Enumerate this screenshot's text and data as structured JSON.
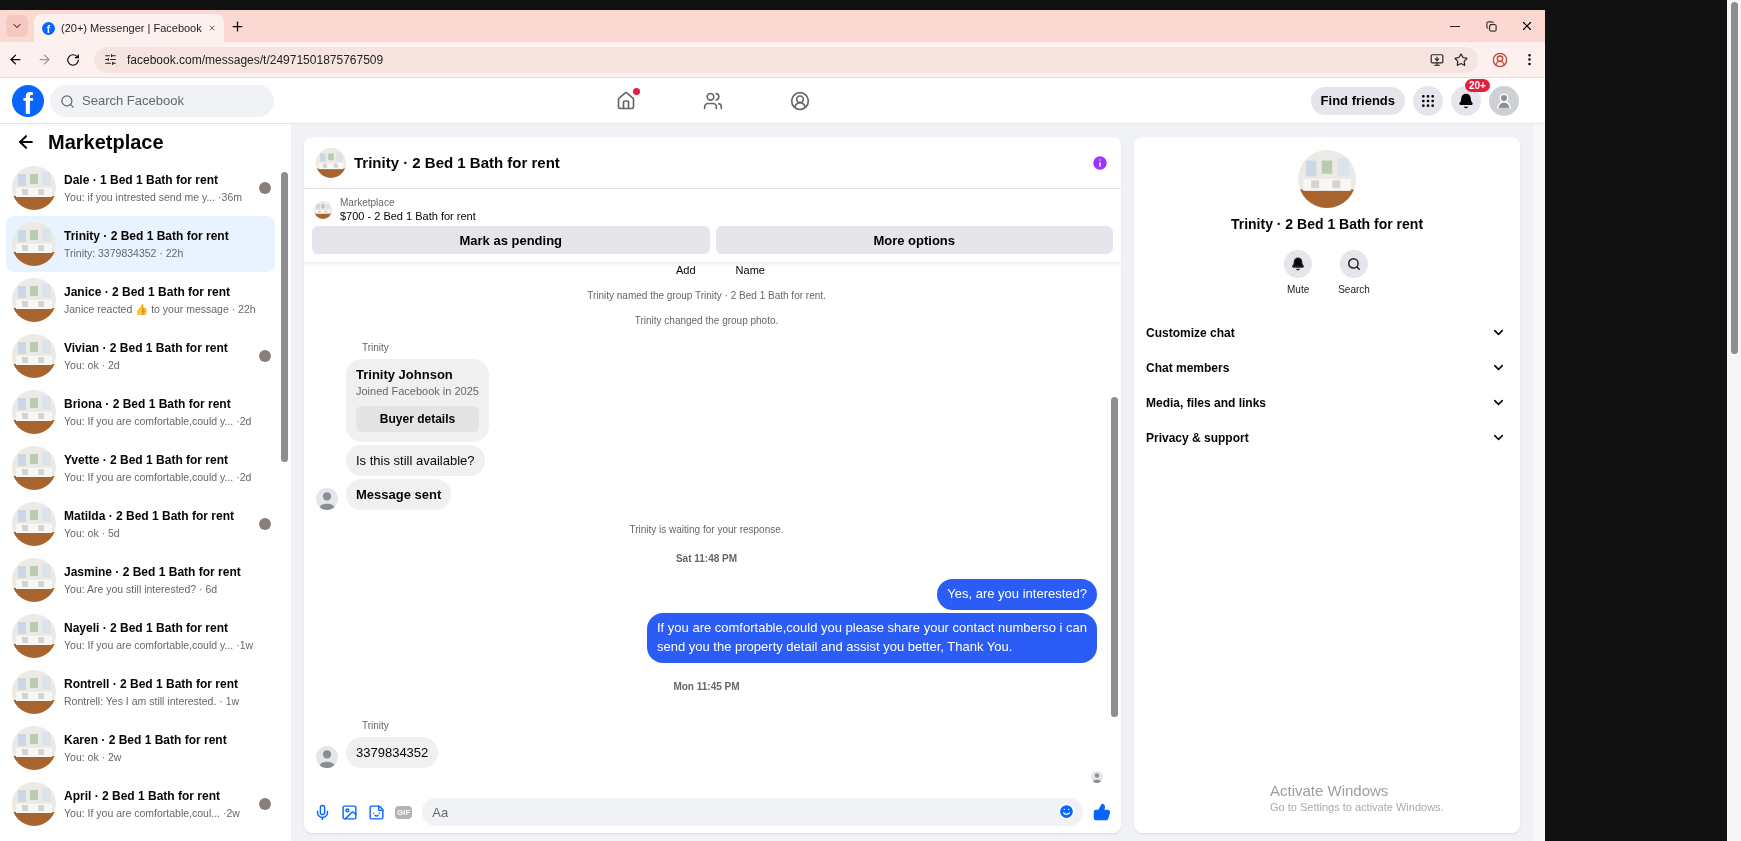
{
  "browser": {
    "favicon": "f",
    "tab_title": "(20+) Messenger | Facebook",
    "url": "facebook.com/messages/t/24971501875767509"
  },
  "header": {
    "logo": "f",
    "search_placeholder": "Search Facebook",
    "nav": [
      {
        "kind": "home",
        "notification_dot": true
      },
      {
        "kind": "friends",
        "notification_dot": false
      },
      {
        "kind": "groups",
        "notification_dot": false
      }
    ],
    "find_friends": "Find friends",
    "notifications_badge": "20+"
  },
  "sidebar": {
    "title": "Marketplace",
    "conversations": [
      {
        "title": "Dale · 1 Bed 1 Bath for rent",
        "preview": "You: if you intrested send me y... ·36m",
        "selected": false,
        "seen": true
      },
      {
        "title": "Trinity · 2 Bed 1 Bath for rent",
        "preview": "Trinity: 3379834352 · 22h",
        "selected": true,
        "seen": false
      },
      {
        "title": "Janice · 2 Bed 1 Bath for rent",
        "preview": "Janice reacted 👍 to your message · 22h",
        "selected": false,
        "seen": false
      },
      {
        "title": "Vivian · 2 Bed 1 Bath for rent",
        "preview": "You: ok · 2d",
        "selected": false,
        "seen": true
      },
      {
        "title": "Briona · 2 Bed 1 Bath for rent",
        "preview": "You: If you are comfortable,could y...  ·2d",
        "selected": false,
        "seen": false
      },
      {
        "title": "Yvette · 2 Bed 1 Bath for rent",
        "preview": "You: If you are comfortable,could y...  ·2d",
        "selected": false,
        "seen": false
      },
      {
        "title": "Matilda · 2 Bed 1 Bath for rent",
        "preview": "You: ok · 5d",
        "selected": false,
        "seen": true
      },
      {
        "title": "Jasmine · 2 Bed 1 Bath for rent",
        "preview": "You: Are you still interested? · 6d",
        "selected": false,
        "seen": false
      },
      {
        "title": "Nayeli · 2 Bed 1 Bath for rent",
        "preview": "You: If you are comfortable,could y...  ·1w",
        "selected": false,
        "seen": false
      },
      {
        "title": "Rontrell · 2 Bed 1 Bath for rent",
        "preview": "Rontrell: Yes I am still interested. · 1w",
        "selected": false,
        "seen": false
      },
      {
        "title": "Karen · 2 Bed 1 Bath for rent",
        "preview": "You: ok · 2w",
        "selected": false,
        "seen": false
      },
      {
        "title": "April · 2 Bed 1 Bath for rent",
        "preview": "You: If you are comfortable,coul...  ·2w",
        "selected": false,
        "seen": true
      }
    ]
  },
  "chat": {
    "title": "Trinity · 2 Bed 1 Bath for rent",
    "listing": {
      "label": "Marketplace",
      "price_line": "$700 - 2 Bed 1 Bath for rent"
    },
    "actions": [
      "Mark as pending",
      "More options"
    ],
    "cut_labels": [
      "Add",
      "Name"
    ],
    "messages": [
      {
        "kind": "system",
        "text": "Trinity named the group Trinity · 2 Bed 1 Bath for rent."
      },
      {
        "kind": "system",
        "text": "Trinity changed the group photo."
      },
      {
        "kind": "sender",
        "text": "Trinity"
      },
      {
        "kind": "profile_card",
        "name": "Trinity Johnson",
        "subtitle": "Joined Facebook in 2025",
        "button": "Buyer details"
      },
      {
        "kind": "incoming",
        "text": "Is this still available?",
        "avatar": false
      },
      {
        "kind": "notice",
        "text": "Message sent",
        "avatar": true
      },
      {
        "kind": "system",
        "text": "Trinity is waiting for your response."
      },
      {
        "kind": "time",
        "text": "Sat 11:48 PM"
      },
      {
        "kind": "outgoing",
        "text": "Yes, are you interested?"
      },
      {
        "kind": "outgoing",
        "text": "If you are comfortable,could you please share your contact numberso i can send you the property detail and assist you better, Thank You."
      },
      {
        "kind": "time",
        "text": "Mon 11:45 PM"
      },
      {
        "kind": "sender",
        "text": "Trinity"
      },
      {
        "kind": "incoming",
        "text": "3379834352",
        "avatar": true
      }
    ],
    "gif_label": "GIF",
    "composer_placeholder": "Aa"
  },
  "details": {
    "title": "Trinity · 2 Bed 1 Bath for rent",
    "actions": [
      {
        "kind": "mute",
        "label": "Mute"
      },
      {
        "kind": "search",
        "label": "Search"
      }
    ],
    "sections": [
      {
        "label": "Customize chat",
        "expanded": false
      },
      {
        "label": "Chat members",
        "expanded": false
      },
      {
        "label": "Media, files and links",
        "expanded": false
      },
      {
        "label": "Privacy & support",
        "expanded": false
      }
    ]
  },
  "os_notice": {
    "title": "Activate Windows",
    "subtitle": "Go to Settings to activate Windows."
  }
}
